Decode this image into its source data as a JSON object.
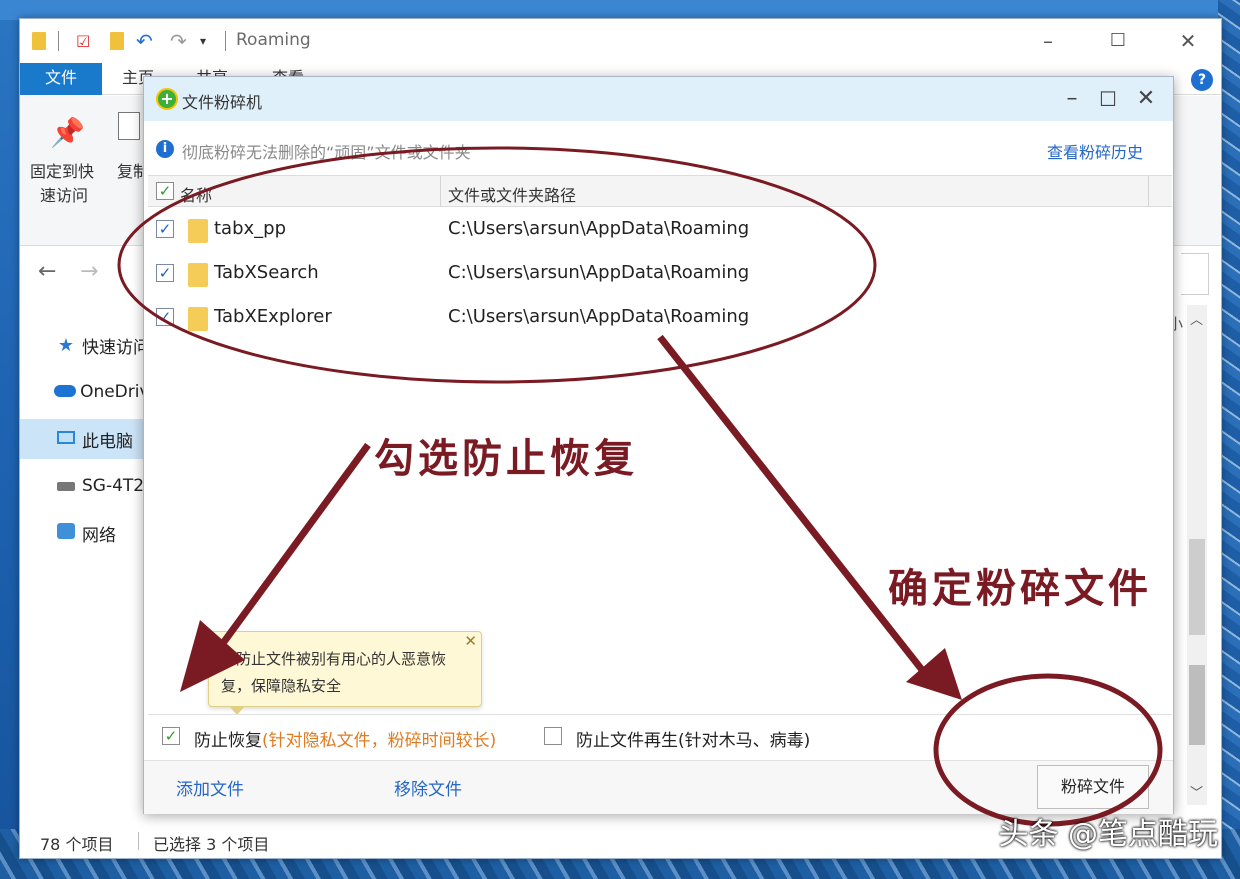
{
  "explorer": {
    "title": "Roaming",
    "tabs": [
      "文件",
      "主页",
      "共享",
      "查看"
    ],
    "ribbon": {
      "pin_label_1": "固定到快",
      "pin_label_2": "速访问",
      "copy_label": "复制"
    },
    "sidebar": [
      "快速访问",
      "OneDrive",
      "此电脑",
      "SG-4T2",
      "网络"
    ],
    "column_small": "小",
    "status": {
      "count": "78 个项目",
      "selected": "已选择 3 个项目"
    }
  },
  "dialog": {
    "title": "文件粉碎机",
    "info": "彻底粉碎无法删除的“顽固”文件或文件夹",
    "history_link": "查看粉碎历史",
    "columns": {
      "name": "名称",
      "path": "文件或文件夹路径"
    },
    "rows": [
      {
        "name": "tabx_pp",
        "path": "C:\\Users\\arsun\\AppData\\Roaming",
        "checked": true
      },
      {
        "name": "TabXSearch",
        "path": "C:\\Users\\arsun\\AppData\\Roaming",
        "checked": true
      },
      {
        "name": "TabXExplorer",
        "path": "C:\\Users\\arsun\\AppData\\Roaming",
        "checked": true
      }
    ],
    "tooltip": "可防止文件被别有用心的人恶意恢复，保障隐私安全",
    "prevent_recovery": {
      "label": "防止恢复",
      "note": "(针对隐私文件，粉碎时间较长)",
      "checked": true
    },
    "prevent_regen": {
      "label": "防止文件再生",
      "note": "(针对木马、病毒)",
      "checked": false
    },
    "add_file": "添加文件",
    "remove_file": "移除文件",
    "shred_button": "粉碎文件"
  },
  "annotations": {
    "check_prevent": "勾选防止恢复",
    "confirm_shred": "确定粉碎文件",
    "color": "#7a1a22"
  },
  "watermark": "头条 @笔点酷玩"
}
